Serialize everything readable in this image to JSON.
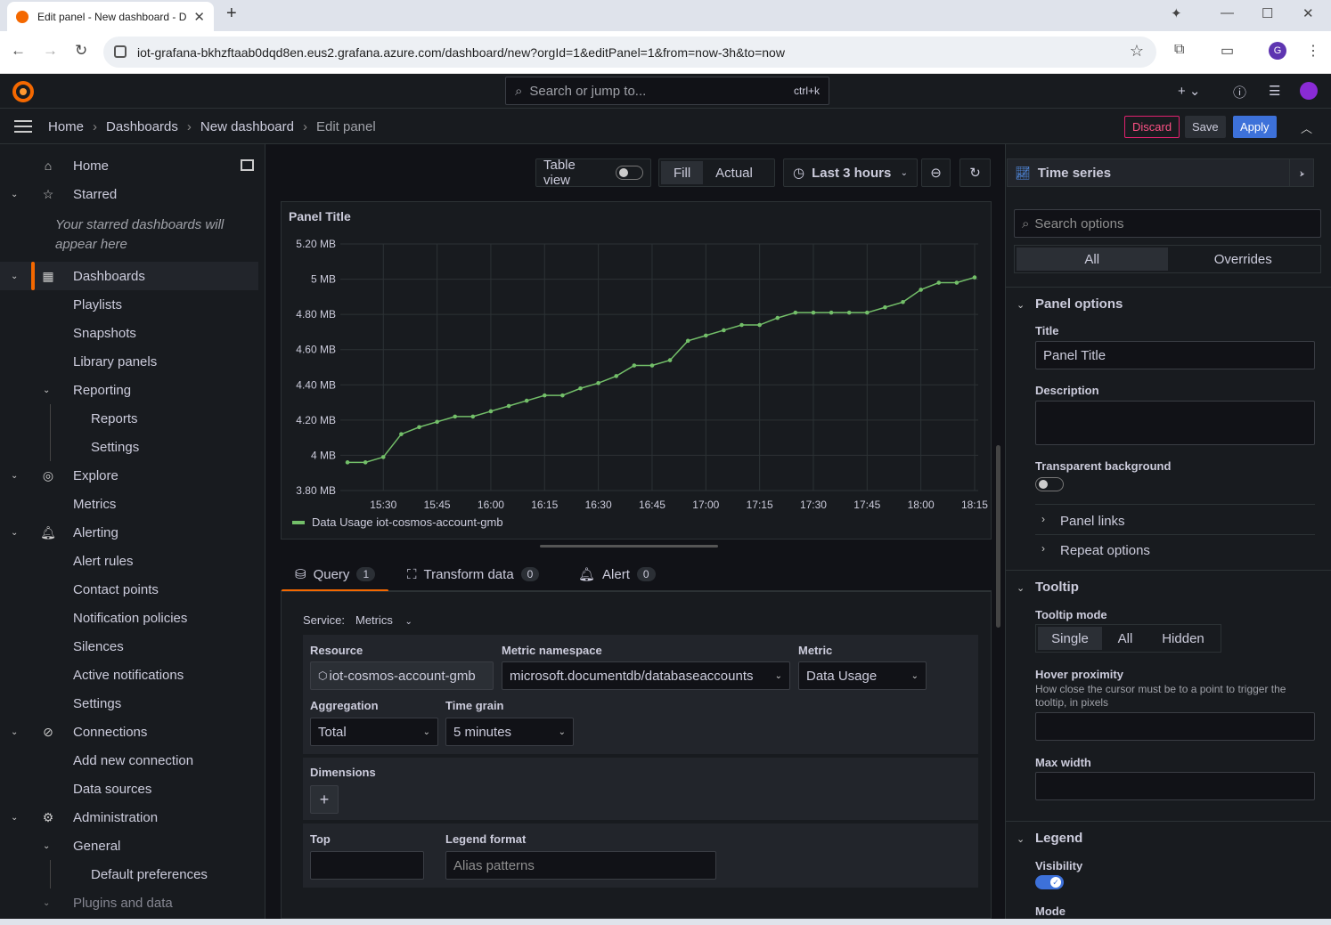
{
  "browser": {
    "tab_title": "Edit panel - New dashboard - D",
    "url": "iot-grafana-bkhzftaab0dqd8en.eus2.grafana.azure.com/dashboard/new?orgId=1&editPanel=1&from=now-3h&to=now",
    "profile_initial": "G"
  },
  "topbar": {
    "search_placeholder": "Search or jump to...",
    "search_shortcut": "ctrl+k"
  },
  "breadcrumb": [
    "Home",
    "Dashboards",
    "New dashboard",
    "Edit panel"
  ],
  "actions": {
    "discard": "Discard",
    "save": "Save",
    "apply": "Apply"
  },
  "sidebar": {
    "starred_note": "Your starred dashboards will appear here",
    "items": [
      {
        "label": "Home"
      },
      {
        "label": "Starred"
      },
      {
        "label": "Dashboards"
      },
      {
        "label": "Playlists"
      },
      {
        "label": "Snapshots"
      },
      {
        "label": "Library panels"
      },
      {
        "label": "Reporting"
      },
      {
        "label": "Reports"
      },
      {
        "label": "Settings"
      },
      {
        "label": "Explore"
      },
      {
        "label": "Metrics"
      },
      {
        "label": "Alerting"
      },
      {
        "label": "Alert rules"
      },
      {
        "label": "Contact points"
      },
      {
        "label": "Notification policies"
      },
      {
        "label": "Silences"
      },
      {
        "label": "Active notifications"
      },
      {
        "label": "Settings"
      },
      {
        "label": "Connections"
      },
      {
        "label": "Add new connection"
      },
      {
        "label": "Data sources"
      },
      {
        "label": "Administration"
      },
      {
        "label": "General"
      },
      {
        "label": "Default preferences"
      },
      {
        "label": "Plugins and data"
      }
    ]
  },
  "panel_toolbar": {
    "table_view": "Table view",
    "fill": "Fill",
    "actual": "Actual",
    "time_range": "Last 3 hours"
  },
  "panel": {
    "title": "Panel Title"
  },
  "chart_data": {
    "type": "line",
    "title": "Panel Title",
    "y_ticks": [
      "5.20 MB",
      "5 MB",
      "4.80 MB",
      "4.60 MB",
      "4.40 MB",
      "4.20 MB",
      "4 MB",
      "3.80 MB"
    ],
    "ylim": [
      3.8,
      5.2
    ],
    "x_ticks": [
      "15:30",
      "15:45",
      "16:00",
      "16:15",
      "16:30",
      "16:45",
      "17:00",
      "17:15",
      "17:30",
      "17:45",
      "18:00",
      "18:15"
    ],
    "series": [
      {
        "name": "Data Usage iot-cosmos-account-gmb",
        "color": "#73bf69",
        "x": [
          "15:20",
          "15:25",
          "15:30",
          "15:35",
          "15:40",
          "15:45",
          "15:50",
          "15:55",
          "16:00",
          "16:05",
          "16:10",
          "16:15",
          "16:20",
          "16:25",
          "16:30",
          "16:35",
          "16:40",
          "16:45",
          "16:50",
          "16:55",
          "17:00",
          "17:05",
          "17:10",
          "17:15",
          "17:20",
          "17:25",
          "17:30",
          "17:35",
          "17:40",
          "17:45",
          "17:50",
          "17:55",
          "18:00",
          "18:05",
          "18:10",
          "18:15"
        ],
        "values": [
          3.96,
          3.96,
          3.99,
          4.12,
          4.16,
          4.19,
          4.22,
          4.22,
          4.25,
          4.28,
          4.31,
          4.34,
          4.34,
          4.38,
          4.41,
          4.45,
          4.51,
          4.51,
          4.54,
          4.65,
          4.68,
          4.71,
          4.74,
          4.74,
          4.78,
          4.81,
          4.81,
          4.81,
          4.81,
          4.81,
          4.84,
          4.87,
          4.94,
          4.98,
          4.98,
          5.01
        ]
      }
    ],
    "grid": true,
    "legend": "bottom"
  },
  "query_tabs": [
    {
      "label": "Query",
      "count": "1"
    },
    {
      "label": "Transform data",
      "count": "0"
    },
    {
      "label": "Alert",
      "count": "0"
    }
  ],
  "query": {
    "service_label": "Service:",
    "service_value": "Metrics",
    "resource_label": "Resource",
    "resource_value": "iot-cosmos-account-gmb",
    "namespace_label": "Metric namespace",
    "namespace_value": "microsoft.documentdb/databaseaccounts",
    "metric_label": "Metric",
    "metric_value": "Data Usage",
    "aggregation_label": "Aggregation",
    "aggregation_value": "Total",
    "timegrain_label": "Time grain",
    "timegrain_value": "5 minutes",
    "dimensions_label": "Dimensions",
    "top_label": "Top",
    "legend_format_label": "Legend format",
    "legend_format_placeholder": "Alias patterns"
  },
  "options": {
    "viz": "Time series",
    "search_placeholder": "Search options",
    "tab_all": "All",
    "tab_overrides": "Overrides",
    "panel_options": "Panel options",
    "title_label": "Title",
    "title_value": "Panel Title",
    "description_label": "Description",
    "transparent_label": "Transparent background",
    "panel_links": "Panel links",
    "repeat_options": "Repeat options",
    "tooltip": "Tooltip",
    "tooltip_mode": "Tooltip mode",
    "mode_single": "Single",
    "mode_all": "All",
    "mode_hidden": "Hidden",
    "hover_label": "Hover proximity",
    "hover_desc": "How close the cursor must be to a point to trigger the tooltip, in pixels",
    "max_width": "Max width",
    "legend": "Legend",
    "visibility": "Visibility",
    "mode": "Mode"
  }
}
